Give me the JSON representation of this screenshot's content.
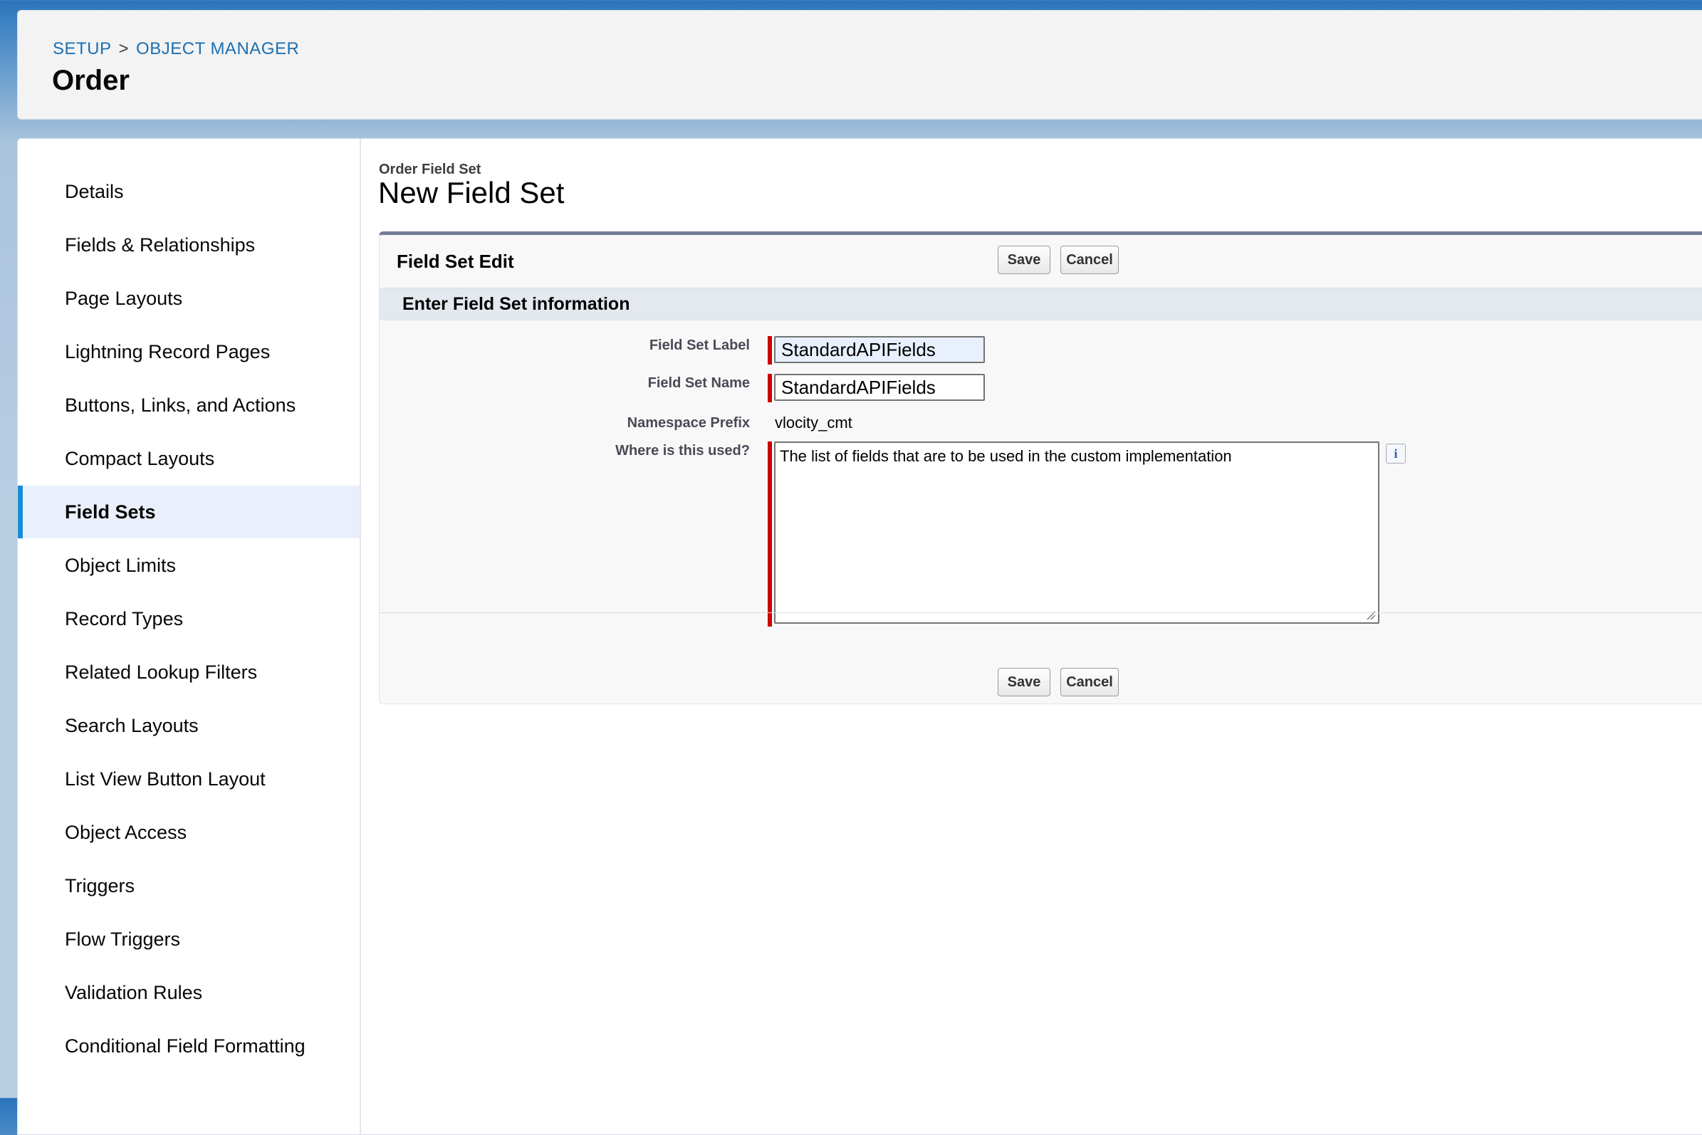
{
  "header": {
    "breadcrumb": [
      "SETUP",
      "OBJECT MANAGER"
    ],
    "separator": ">",
    "title": "Order"
  },
  "sidebar": {
    "items": [
      {
        "label": "Details"
      },
      {
        "label": "Fields & Relationships"
      },
      {
        "label": "Page Layouts"
      },
      {
        "label": "Lightning Record Pages"
      },
      {
        "label": "Buttons, Links, and Actions"
      },
      {
        "label": "Compact Layouts"
      },
      {
        "label": "Field Sets",
        "active": true
      },
      {
        "label": "Object Limits"
      },
      {
        "label": "Record Types"
      },
      {
        "label": "Related Lookup Filters"
      },
      {
        "label": "Search Layouts"
      },
      {
        "label": "List View Button Layout"
      },
      {
        "label": "Object Access"
      },
      {
        "label": "Triggers"
      },
      {
        "label": "Flow Triggers"
      },
      {
        "label": "Validation Rules"
      },
      {
        "label": "Conditional Field Formatting"
      }
    ]
  },
  "main": {
    "object_label": "Order Field Set",
    "title": "New Field Set",
    "block_title": "Field Set Edit",
    "save_label": "Save",
    "cancel_label": "Cancel",
    "section_title": "Enter Field Set information",
    "fields": {
      "label_label": "Field Set Label",
      "label_value": "StandardAPIFields",
      "name_label": "Field Set Name",
      "name_value": "StandardAPIFields",
      "namespace_label": "Namespace Prefix",
      "namespace_value": "vlocity_cmt",
      "where_label": "Where is this used?",
      "where_value": "The list of fields that are to be used in the custom implementation",
      "info_icon_glyph": "i"
    }
  },
  "colors": {
    "required": "#cc0000",
    "active_nav": "#1b8bd6",
    "link": "#1c6fb0"
  }
}
